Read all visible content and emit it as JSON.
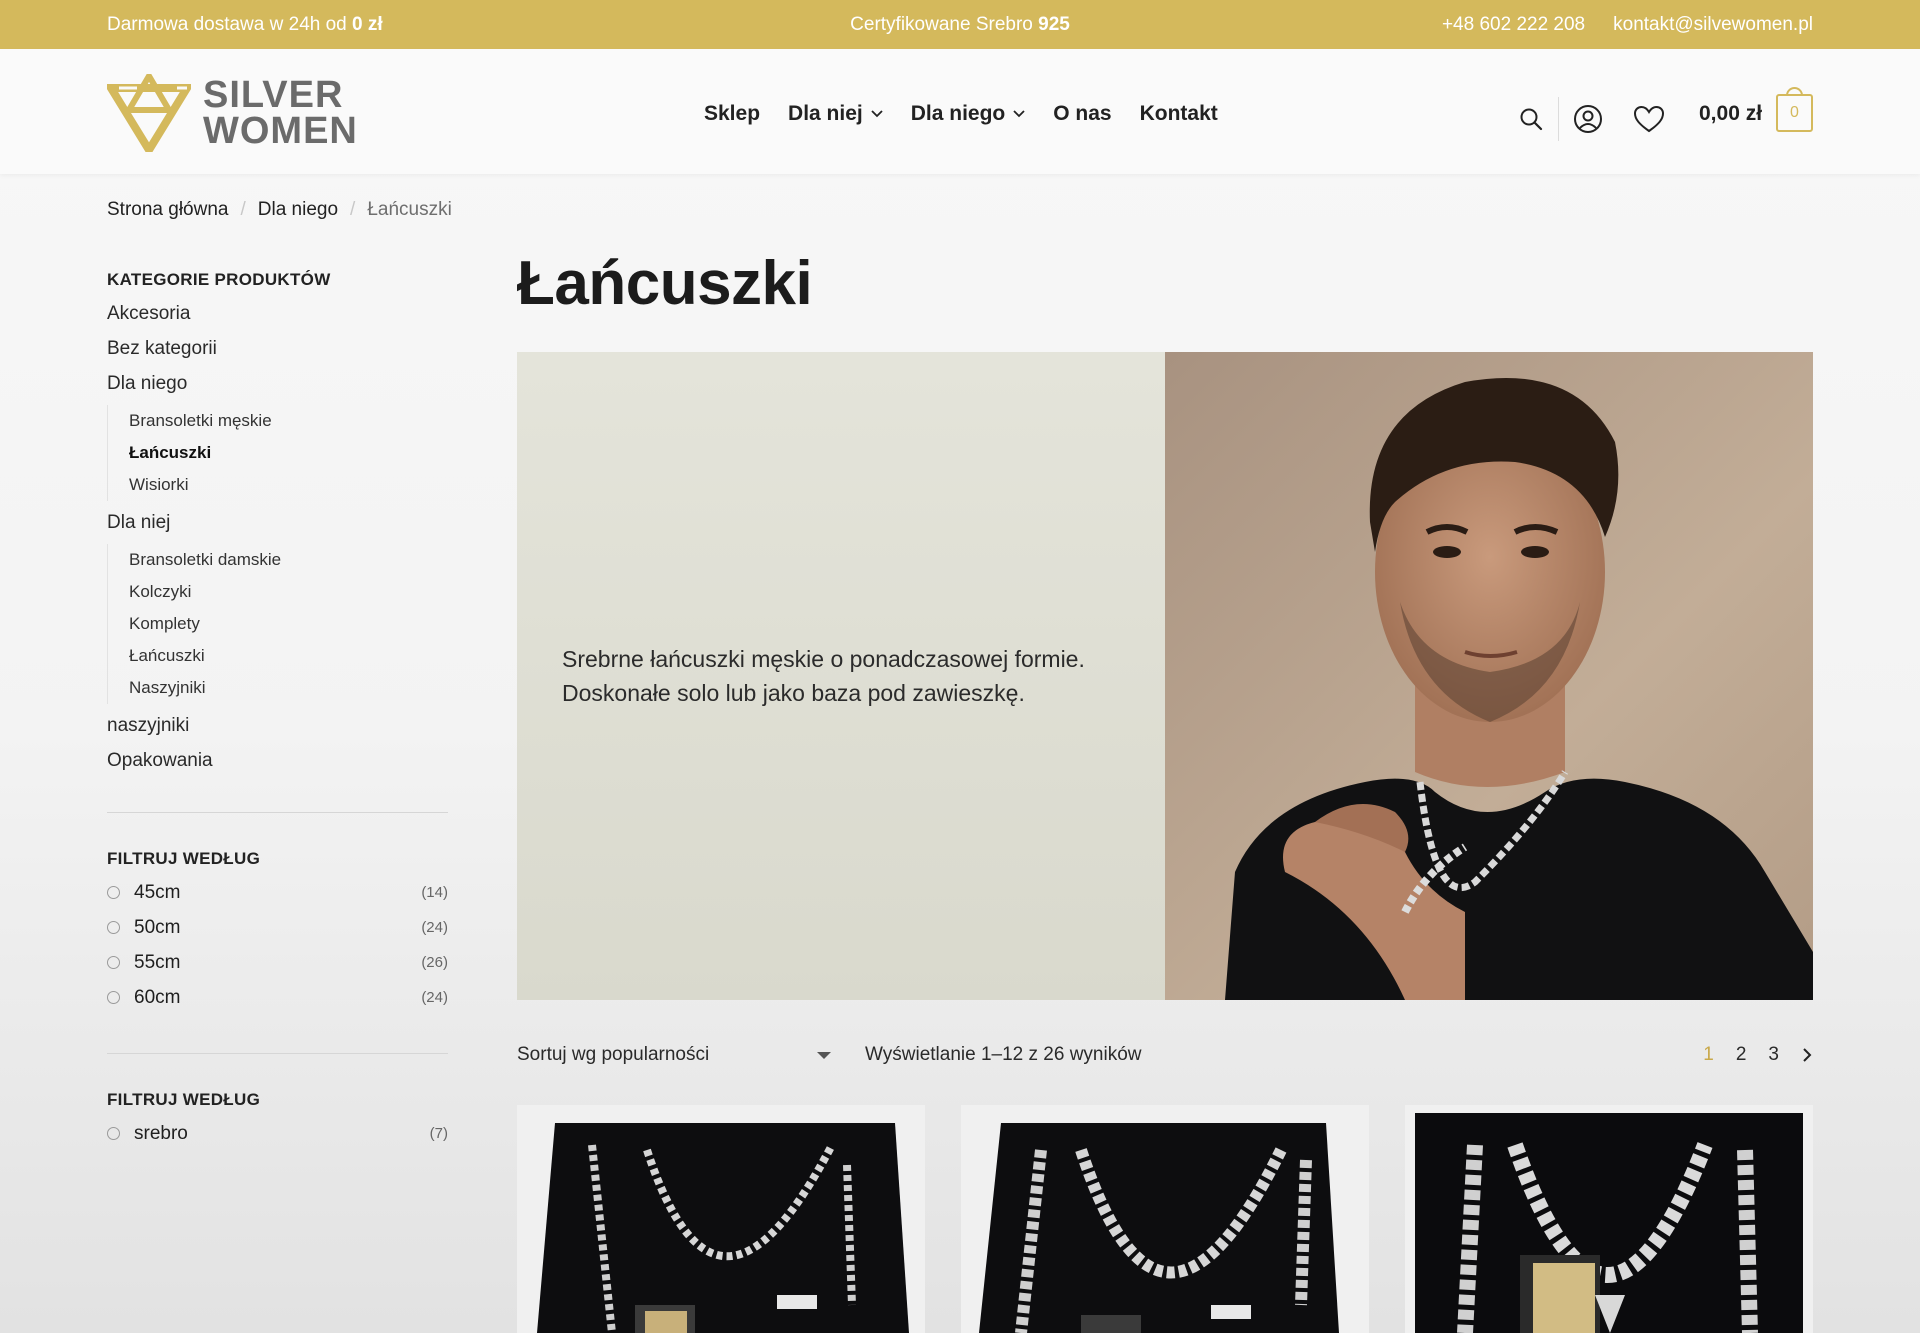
{
  "topbar": {
    "shipping_prefix": "Darmowa dostawa w 24h od ",
    "shipping_bold": "0 zł",
    "cert_prefix": "Certyfikowane Srebro ",
    "cert_bold": "925",
    "phone": "+48 602 222 208",
    "email": "kontakt@silvewomen.pl",
    "color": "#d4b95c"
  },
  "logo": {
    "line1": "SILVER",
    "line2": "WOMEN"
  },
  "nav": [
    {
      "label": "Sklep",
      "dropdown": false
    },
    {
      "label": "Dla niej",
      "dropdown": true
    },
    {
      "label": "Dla niego",
      "dropdown": true
    },
    {
      "label": "O nas",
      "dropdown": false
    },
    {
      "label": "Kontakt",
      "dropdown": false
    }
  ],
  "header_icons": [
    "search-icon",
    "account-icon",
    "heart-icon"
  ],
  "cart": {
    "total": "0,00 zł",
    "count": "0"
  },
  "breadcrumb": {
    "home": "Strona główna",
    "parent": "Dla niego",
    "current": "Łańcuszki",
    "separator": "/"
  },
  "sidebar": {
    "categories_title": "KATEGORIE PRODUKTÓW",
    "categories": [
      {
        "label": "Akcesoria"
      },
      {
        "label": "Bez kategorii"
      },
      {
        "label": "Dla niego",
        "children": [
          {
            "label": "Bransoletki męskie",
            "active": false
          },
          {
            "label": "Łańcuszki",
            "active": true
          },
          {
            "label": "Wisiorki",
            "active": false
          }
        ]
      },
      {
        "label": "Dla niej",
        "children": [
          {
            "label": "Bransoletki damskie",
            "active": false
          },
          {
            "label": "Kolczyki",
            "active": false
          },
          {
            "label": "Komplety",
            "active": false
          },
          {
            "label": "Łańcuszki",
            "active": false
          },
          {
            "label": "Naszyjniki",
            "active": false
          }
        ]
      },
      {
        "label": "naszyjniki"
      },
      {
        "label": "Opakowania"
      }
    ],
    "filter1": {
      "title": "FILTRUJ WEDŁUG",
      "options": [
        {
          "label": "45cm",
          "count": "(14)"
        },
        {
          "label": "50cm",
          "count": "(24)"
        },
        {
          "label": "55cm",
          "count": "(26)"
        },
        {
          "label": "60cm",
          "count": "(24)"
        }
      ]
    },
    "filter2": {
      "title": "FILTRUJ WEDŁUG",
      "options": [
        {
          "label": "srebro",
          "count": "(7)"
        }
      ]
    }
  },
  "page_title": "Łańcuszki",
  "banner": {
    "line1": "Srebrne łańcuszki męskie o ponadczasowej formie.",
    "line2": "Doskonałe solo lub jako baza pod zawieszkę."
  },
  "toolbar": {
    "sort_label": "Sortuj wg popularności",
    "results_text": "Wyświetlanie 1–12 z 26 wyników",
    "pages": [
      "1",
      "2",
      "3"
    ],
    "current_page": "1"
  },
  "accent_color": "#c9a94a"
}
